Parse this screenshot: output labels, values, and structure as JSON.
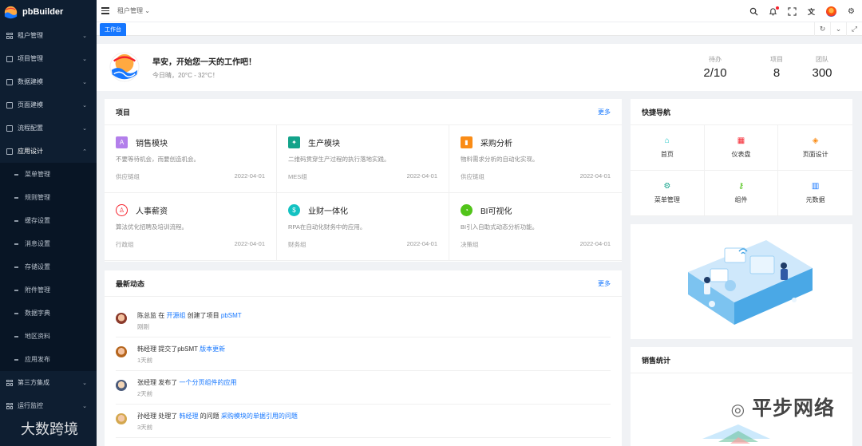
{
  "app": {
    "name": "pbBuilder"
  },
  "sidebar": {
    "items": [
      {
        "label": "租户管理"
      },
      {
        "label": "项目管理"
      },
      {
        "label": "数据建模"
      },
      {
        "label": "页面建模"
      },
      {
        "label": "流程配置"
      },
      {
        "label": "应用设计"
      }
    ],
    "sub_items": [
      {
        "label": "菜单管理"
      },
      {
        "label": "规则管理"
      },
      {
        "label": "缓存设置"
      },
      {
        "label": "消息设置"
      },
      {
        "label": "存储设置"
      },
      {
        "label": "附件管理"
      },
      {
        "label": "数据字典"
      },
      {
        "label": "地区资料"
      },
      {
        "label": "应用发布"
      }
    ],
    "after_items": [
      {
        "label": "第三方集成"
      },
      {
        "label": "运行监控"
      }
    ]
  },
  "topbar": {
    "breadcrumb": "租户管理 ⌄"
  },
  "tabs": {
    "active": "工作台"
  },
  "welcome": {
    "greeting": "早安，开始您一天的工作吧！",
    "weather": "今日晴，20°C - 32°C！",
    "stats": [
      {
        "label": "待办",
        "value": "2/10"
      },
      {
        "label": "项目",
        "value": "8"
      },
      {
        "label": "团队",
        "value": "300"
      }
    ]
  },
  "projects": {
    "title": "项目",
    "more": "更多",
    "items": [
      {
        "name": "销售模块",
        "desc": "不要等待机会，而要创造机会。",
        "group": "供应链组",
        "date": "2022-04-01",
        "color": "#b37feb"
      },
      {
        "name": "生产模块",
        "desc": "二维码贯穿生产过程的执行落地实践。",
        "group": "MES组",
        "date": "2022-04-01",
        "color": "#13a38a"
      },
      {
        "name": "采购分析",
        "desc": "物料需求分析的自动化实现。",
        "group": "供应链组",
        "date": "2022-04-01",
        "color": "#fa8c16"
      },
      {
        "name": "人事薪资",
        "desc": "算法优化招聘及培训流程。",
        "group": "行政组",
        "date": "2022-04-01",
        "color": "#f5222d"
      },
      {
        "name": "业财一体化",
        "desc": "RPA在自动化财务中的应用。",
        "group": "财务组",
        "date": "2022-04-01",
        "color": "#13c2c2"
      },
      {
        "name": "BI可视化",
        "desc": "BI引入自助式动态分析功能。",
        "group": "决策组",
        "date": "2022-04-01",
        "color": "#52c41a"
      }
    ]
  },
  "activity": {
    "title": "最新动态",
    "more": "更多",
    "items": [
      {
        "p1": "陈总监 在 ",
        "l1": "开源组",
        "p2": " 创建了项目 ",
        "l2": "pbSMT",
        "time": "刚刚"
      },
      {
        "p1": "韩经理 提交了pbSMT ",
        "l1": "版本更新",
        "p2": "",
        "l2": "",
        "time": "1天前"
      },
      {
        "p1": "张经理 发布了 ",
        "l1": "一个分页组件的应用",
        "p2": "",
        "l2": "",
        "time": "2天前"
      },
      {
        "p1": "孙经理 处理了 ",
        "l1": "韩经理",
        "p2": " 的问题 ",
        "l2": "采购模块的单据引用的问题",
        "time": "3天前"
      }
    ]
  },
  "quicknav": {
    "title": "快捷导航",
    "items": [
      {
        "label": "首页",
        "icon": "home-icon"
      },
      {
        "label": "仪表盘",
        "icon": "dashboard-icon"
      },
      {
        "label": "页面设计",
        "icon": "page-design-icon"
      },
      {
        "label": "菜单管理",
        "icon": "menu-settings-icon"
      },
      {
        "label": "组件",
        "icon": "component-icon"
      },
      {
        "label": "元数据",
        "icon": "metadata-icon"
      }
    ]
  },
  "sales": {
    "title": "销售统计"
  },
  "watermarks": {
    "right": "平步网络",
    "left": "大数跨境"
  }
}
